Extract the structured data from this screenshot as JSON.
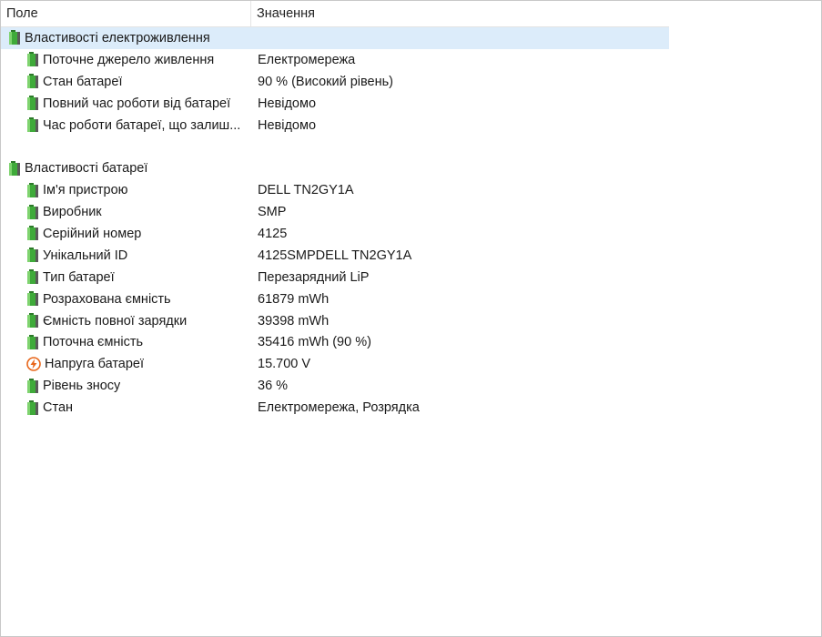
{
  "header": {
    "field_label": "Поле",
    "value_label": "Значення"
  },
  "groups": [
    {
      "title": "Властивості електроживлення",
      "icon": "battery-icon",
      "selected": true,
      "items": [
        {
          "field": "Поточне джерело живлення",
          "value": "Електромережа",
          "icon": "battery-icon"
        },
        {
          "field": "Стан батареї",
          "value": "90 % (Високий рівень)",
          "icon": "battery-icon"
        },
        {
          "field": "Повний час роботи від батареї",
          "value": "Невідомо",
          "icon": "battery-icon"
        },
        {
          "field": "Час роботи батареї, що залиш...",
          "value": "Невідомо",
          "icon": "battery-icon"
        }
      ]
    },
    {
      "title": "Властивості батареї",
      "icon": "battery-icon",
      "selected": false,
      "items": [
        {
          "field": "Ім'я пристрою",
          "value": "DELL TN2GY1A",
          "icon": "battery-icon"
        },
        {
          "field": "Виробник",
          "value": "SMP",
          "icon": "battery-icon"
        },
        {
          "field": "Серійний номер",
          "value": "4125",
          "icon": "battery-icon"
        },
        {
          "field": "Унікальний ID",
          "value": "4125SMPDELL TN2GY1A",
          "icon": "battery-icon"
        },
        {
          "field": "Тип батареї",
          "value": "Перезарядний LiP",
          "icon": "battery-icon"
        },
        {
          "field": "Розрахована ємність",
          "value": "61879 mWh",
          "icon": "battery-icon"
        },
        {
          "field": "Ємність повної зарядки",
          "value": "39398 mWh",
          "icon": "battery-icon"
        },
        {
          "field": "Поточна ємність",
          "value": "35416 mWh  (90 %)",
          "icon": "battery-icon"
        },
        {
          "field": "Напруга батареї",
          "value": "15.700 V",
          "icon": "bolt-icon"
        },
        {
          "field": "Рівень зносу",
          "value": "36 %",
          "icon": "battery-icon"
        },
        {
          "field": "Стан",
          "value": "Електромережа, Розрядка",
          "icon": "battery-icon"
        }
      ]
    }
  ],
  "colors": {
    "selection": "#dcecfa",
    "battery_green": "#3faa3a",
    "bolt_orange": "#e8661a"
  }
}
